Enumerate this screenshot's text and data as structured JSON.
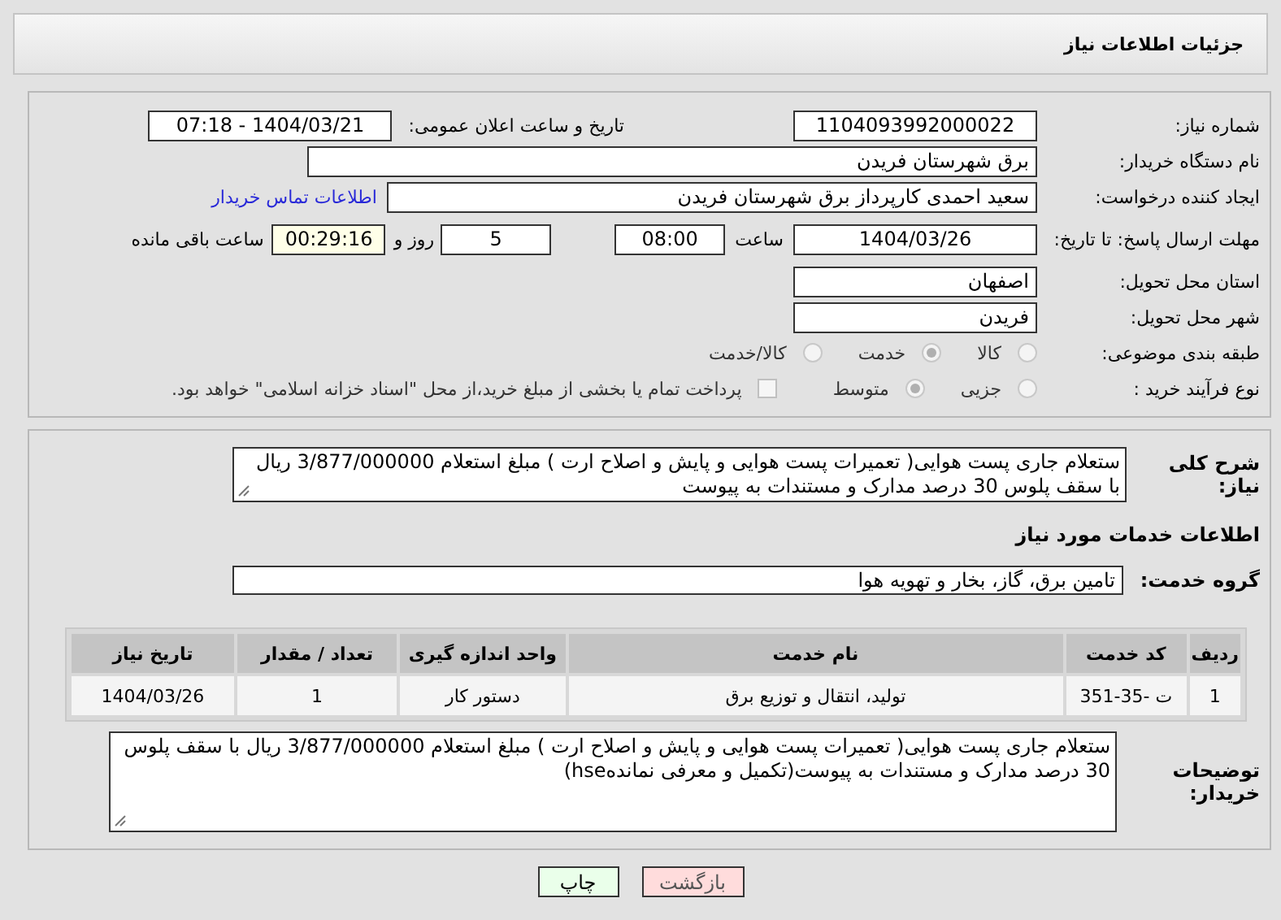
{
  "header": {
    "title": "جزئیات اطلاعات نیاز"
  },
  "details": {
    "need_number": {
      "label": "شماره نیاز:",
      "value": "1104093992000022"
    },
    "announce": {
      "label": "تاریخ و ساعت اعلان عمومی:",
      "value": "1404/03/21 - 07:18"
    },
    "buyer_org": {
      "label": "نام دستگاه خریدار:",
      "value": "برق شهرستان فریدن"
    },
    "creator": {
      "label": "ایجاد کننده درخواست:",
      "value": "سعید احمدی کارپرداز برق شهرستان فریدن",
      "link": "اطلاعات تماس خریدار"
    },
    "deadline": {
      "label": "مهلت ارسال پاسخ: تا تاریخ:",
      "date": "1404/03/26",
      "time_label": "ساعت",
      "time": "08:00",
      "days": "5",
      "days_label": "روز و",
      "remaining": "00:29:16",
      "remaining_label": "ساعت باقی مانده"
    },
    "province": {
      "label": "استان محل تحویل:",
      "value": "اصفهان"
    },
    "city": {
      "label": "شهر محل تحویل:",
      "value": "فریدن"
    },
    "category": {
      "label": "طبقه بندی موضوعی:",
      "options": [
        {
          "kind": "radio",
          "label": "کالا",
          "selected": false
        },
        {
          "kind": "radio",
          "label": "خدمت",
          "selected": true
        },
        {
          "kind": "radio",
          "label": "کالا/خدمت",
          "selected": false
        }
      ]
    },
    "process": {
      "label": "نوع فرآیند خرید :",
      "options": [
        {
          "kind": "radio",
          "label": "جزیی",
          "selected": false
        },
        {
          "kind": "radio",
          "label": "متوسط",
          "selected": true
        },
        {
          "kind": "checkbox",
          "label": "پرداخت تمام یا بخشی از مبلغ خرید،از محل \"اسناد خزانه اسلامی\" خواهد بود.",
          "checked": false
        }
      ]
    }
  },
  "needs": {
    "description": {
      "label": "شرح کلی نیاز:",
      "value": "ستعلام جاری پست هوایی( تعمیرات پست هوایی و پایش و اصلاح ارت ) مبلغ استعلام 3/877/000000 ریال با سقف پلوس 30 درصد مدارک و مستندات به پیوست"
    },
    "services_heading": "اطلاعات خدمات مورد نیاز",
    "service_group": {
      "label": "گروه خدمت:",
      "value": "تامین برق، گاز، بخار و تهویه هوا"
    },
    "table": {
      "columns": [
        "ردیف",
        "کد خدمت",
        "نام خدمت",
        "واحد اندازه گیری",
        "تعداد / مقدار",
        "تاریخ نیاز"
      ],
      "rows": [
        [
          "1",
          "ت -35-351",
          "تولید، انتقال و توزیع برق",
          "دستور کار",
          "1",
          "1404/03/26"
        ]
      ]
    },
    "buyer_notes": {
      "label": "توضیحات خریدار:",
      "value": "ستعلام جاری پست هوایی( تعمیرات پست هوایی و پایش و اصلاح ارت ) مبلغ استعلام 3/877/000000 ریال با سقف پلوس 30 درصد مدارک و مستندات به پیوست(تکمیل و معرفی نماندهhse)"
    }
  },
  "buttons": [
    {
      "kind": "back",
      "label": "بازگشت"
    },
    {
      "kind": "print",
      "label": "چاپ"
    }
  ]
}
